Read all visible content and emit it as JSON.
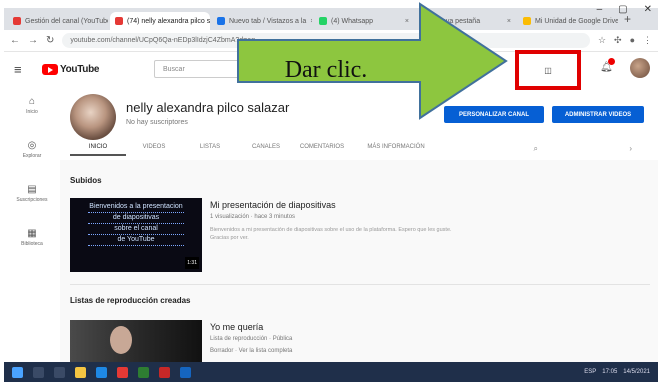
{
  "browser": {
    "tabs": [
      {
        "label": "Gestión del canal (YouTube)",
        "color": "#e53935"
      },
      {
        "label": "(74) nelly alexandra pilco s",
        "color": "#e53935"
      },
      {
        "label": "Nuevo tab / Vistazos a la",
        "color": "#1a73e8"
      },
      {
        "label": "(4) Whatsapp",
        "color": "#25d366"
      },
      {
        "label": "Nueva pestaña",
        "color": "#1a73e8"
      },
      {
        "label": "Mi Unidad de Google Drive",
        "color": "#fbbc04"
      }
    ],
    "url": "youtube.com/channel/UCpQ6Qa-nEDp3lIdzjC4ZbmA?d=ag"
  },
  "youtube": {
    "logo_text": "YouTube",
    "search_placeholder": "Buscar",
    "create_label": "◫"
  },
  "sidebar": {
    "items": [
      {
        "icon": "⌂",
        "label": "Inicio",
        "icon_name": "home-icon"
      },
      {
        "icon": "◎",
        "label": "Explorar",
        "icon_name": "explore-icon"
      },
      {
        "icon": "▤",
        "label": "Suscripciones",
        "icon_name": "subscriptions-icon"
      },
      {
        "icon": "▦",
        "label": "Biblioteca",
        "icon_name": "library-icon"
      }
    ]
  },
  "channel": {
    "name": "nelly alexandra pilco salazar",
    "subscribers": "No hay suscriptores",
    "customize_button": "PERSONALIZAR CANAL",
    "manage_button": "ADMINISTRAR VIDEOS",
    "tabs": [
      "INICIO",
      "VIDEOS",
      "LISTAS",
      "CANALES",
      "COMENTARIOS",
      "MÁS INFORMACIÓN"
    ]
  },
  "uploads": {
    "section_title": "Subidos",
    "video": {
      "title": "Mi presentación de diapositivas",
      "meta": "1 visualización · hace 3 minutos",
      "description": "Bienvenidos a mi presentación de diapositivas sobre el uso de la plataforma. Espero que les guste. Gracias por ver.",
      "duration": "1:31",
      "thumb_lines": [
        "Bienvenidos a la presentacion",
        "de diapositivas",
        "sobre el canal",
        "de YouTube"
      ]
    }
  },
  "playlists": {
    "section_title": "Listas de reproducción creadas",
    "item": {
      "title": "Yo me quería",
      "meta": "Lista de reproducción · Pública",
      "submeta": "Borrador · Ver la lista completa"
    }
  },
  "overlay": {
    "callout_text": "Dar clic.",
    "arrow_color": "#8dc63f",
    "arrow_border": "#41719c",
    "highlight_color": "#e00000"
  },
  "taskbar": {
    "tray_text": "ESP",
    "time": "17:05",
    "date": "14/5/2021"
  }
}
